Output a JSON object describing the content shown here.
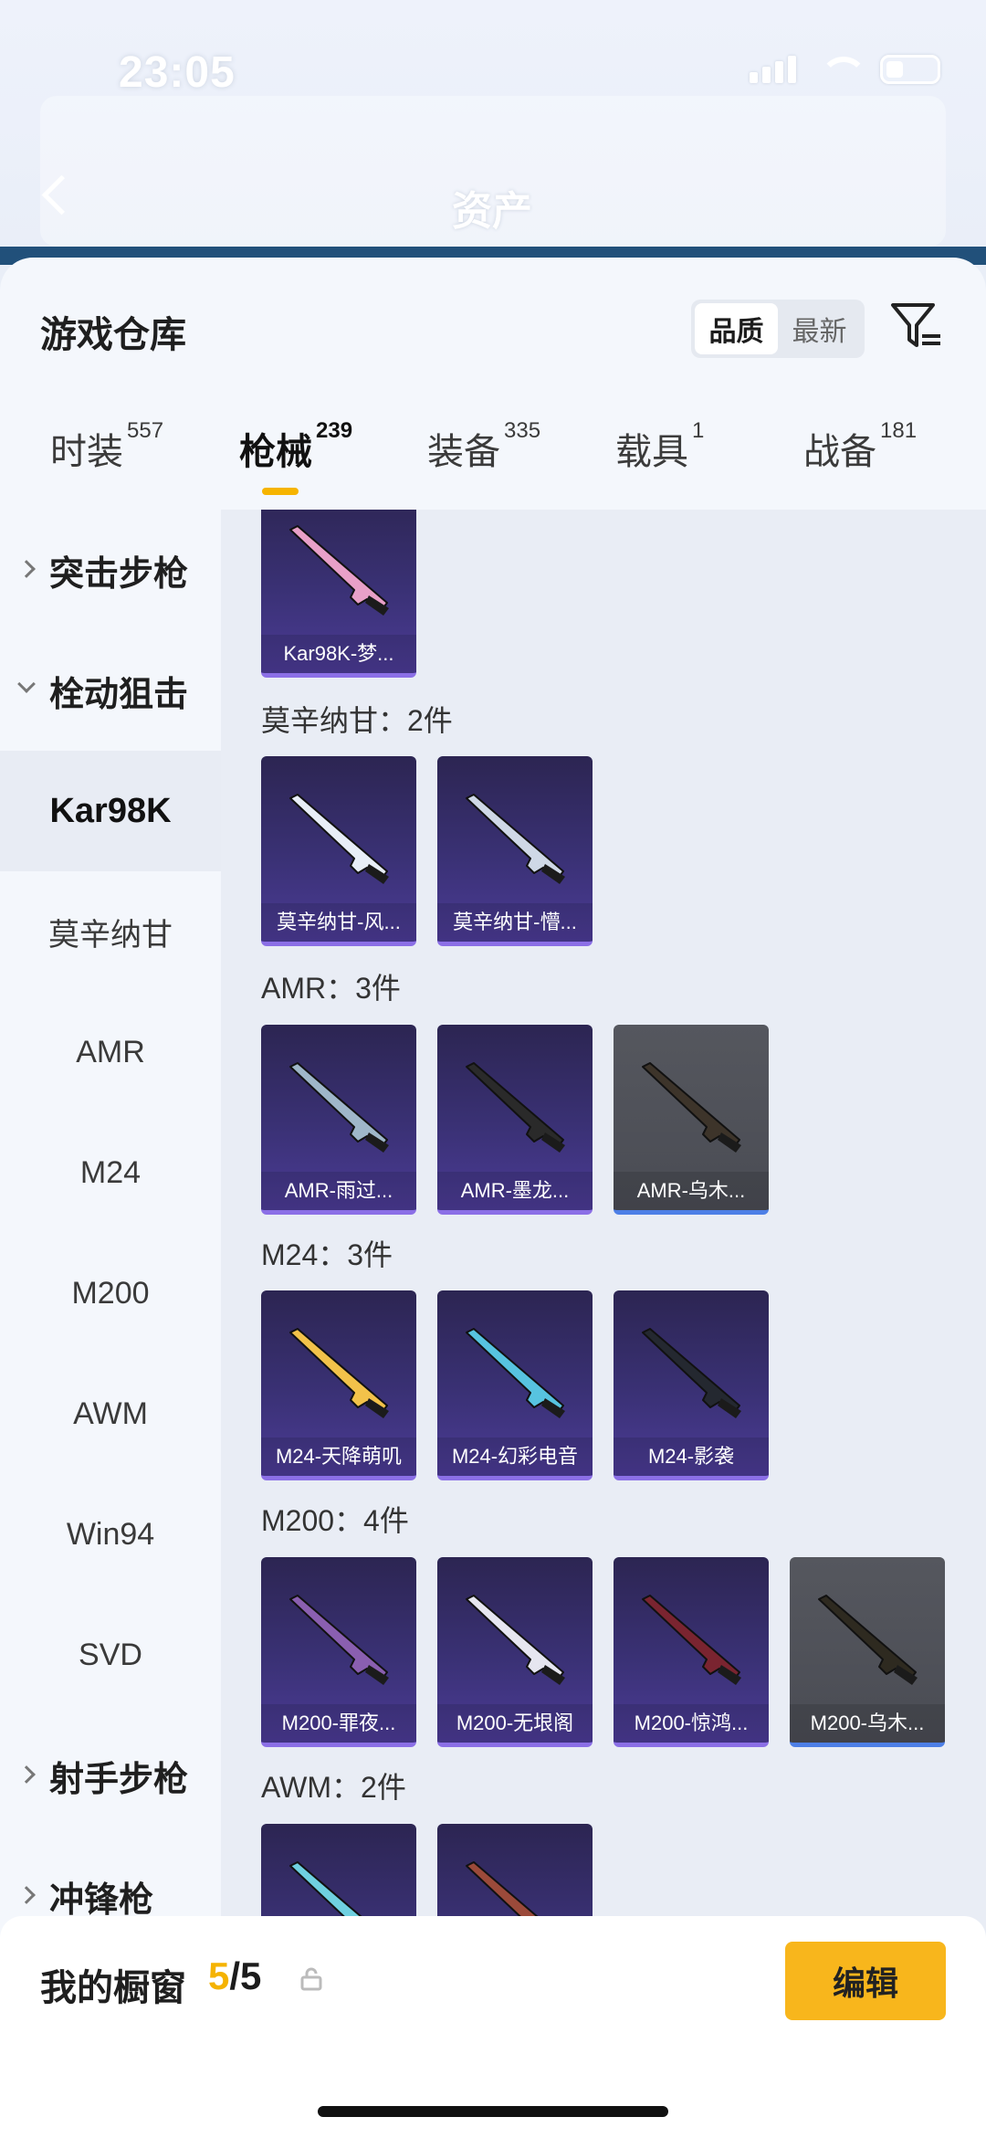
{
  "status": {
    "time": "23:05"
  },
  "background": {
    "title": "资产"
  },
  "sheet": {
    "title": "游戏仓库"
  },
  "sort": {
    "options": [
      "品质",
      "最新"
    ],
    "active": 0
  },
  "tabs": [
    {
      "label": "时装",
      "count": "557"
    },
    {
      "label": "枪械",
      "count": "239"
    },
    {
      "label": "装备",
      "count": "335"
    },
    {
      "label": "载具",
      "count": "1"
    },
    {
      "label": "战备",
      "count": "181"
    }
  ],
  "sidebar": {
    "items": [
      {
        "label": "突击步枪",
        "type": "group",
        "expanded": false
      },
      {
        "label": "栓动狙击",
        "type": "group",
        "expanded": true
      },
      {
        "label": "Kar98K",
        "type": "item",
        "selected": true
      },
      {
        "label": "莫辛纳甘",
        "type": "item"
      },
      {
        "label": "AMR",
        "type": "item"
      },
      {
        "label": "M24",
        "type": "item"
      },
      {
        "label": "M200",
        "type": "item"
      },
      {
        "label": "AWM",
        "type": "item"
      },
      {
        "label": "Win94",
        "type": "item"
      },
      {
        "label": "SVD",
        "type": "item"
      },
      {
        "label": "射手步枪",
        "type": "group",
        "expanded": false
      },
      {
        "label": "冲锋枪",
        "type": "group",
        "expanded": false
      }
    ]
  },
  "sections": [
    {
      "label": "",
      "cards": [
        {
          "name": "Kar98K-梦...",
          "rarity": "purple"
        }
      ]
    },
    {
      "label": "莫辛纳甘：2件",
      "cards": [
        {
          "name": "莫辛纳甘-风...",
          "rarity": "purple"
        },
        {
          "name": "莫辛纳甘-懵...",
          "rarity": "purple"
        }
      ]
    },
    {
      "label": "AMR：3件",
      "cards": [
        {
          "name": "AMR-雨过...",
          "rarity": "purple"
        },
        {
          "name": "AMR-墨龙...",
          "rarity": "purple"
        },
        {
          "name": "AMR-乌木...",
          "rarity": "grey"
        }
      ]
    },
    {
      "label": "M24：3件",
      "cards": [
        {
          "name": "M24-天降萌叽",
          "rarity": "purple"
        },
        {
          "name": "M24-幻彩电音",
          "rarity": "purple"
        },
        {
          "name": "M24-影袭",
          "rarity": "purple"
        }
      ]
    },
    {
      "label": "M200：4件",
      "cards": [
        {
          "name": "M200-罪夜...",
          "rarity": "purple"
        },
        {
          "name": "M200-无垠阁",
          "rarity": "purple"
        },
        {
          "name": "M200-惊鸿...",
          "rarity": "purple"
        },
        {
          "name": "M200-乌木...",
          "rarity": "grey"
        }
      ]
    },
    {
      "label": "AWM：2件",
      "cards": [
        {
          "name": "",
          "rarity": "purple"
        },
        {
          "name": "",
          "rarity": "purple"
        }
      ]
    }
  ],
  "footer": {
    "title": "我的橱窗",
    "current": "5",
    "separator": "/",
    "total": "5",
    "edit_label": "编辑"
  },
  "colors": {
    "accent": "#f8b61c",
    "purple_card": "#3a3175",
    "grey_card": "#4a4c54"
  },
  "icons": [
    "back-icon",
    "filter-icon",
    "share-icon",
    "lock-icon",
    "chevron-right-icon",
    "chevron-down-icon"
  ]
}
